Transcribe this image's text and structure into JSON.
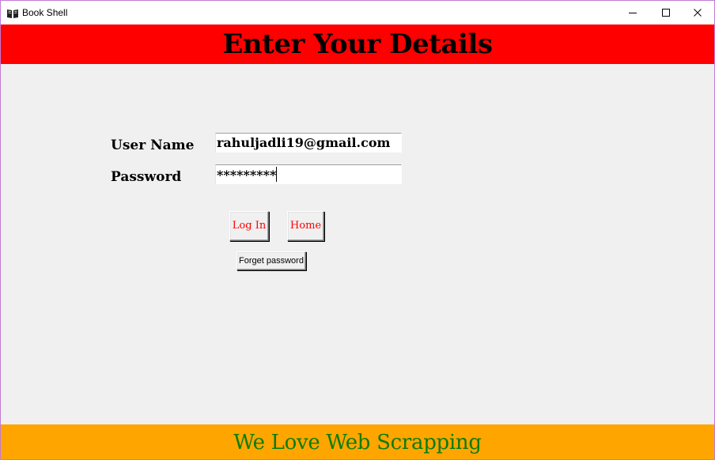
{
  "window": {
    "title": "Book Shell",
    "icon": "open-book-icon",
    "controls": [
      "minimize-icon",
      "maximize-icon",
      "close-icon"
    ],
    "border_color": "#c27ad6"
  },
  "header": {
    "title": "Enter Your Details",
    "background": "#ff0000"
  },
  "form": {
    "username_label": "User Name",
    "username_value": "rahuljadli19@gmail.com",
    "password_label": "Password",
    "password_value": "*********"
  },
  "buttons": {
    "login_label": "Log In",
    "home_label": "Home",
    "forget_label": "Forget password",
    "text_color": "#ff0000"
  },
  "footer": {
    "text": "We Love Web Scrapping",
    "background": "#ffa500",
    "text_color": "#0a7d0a"
  }
}
